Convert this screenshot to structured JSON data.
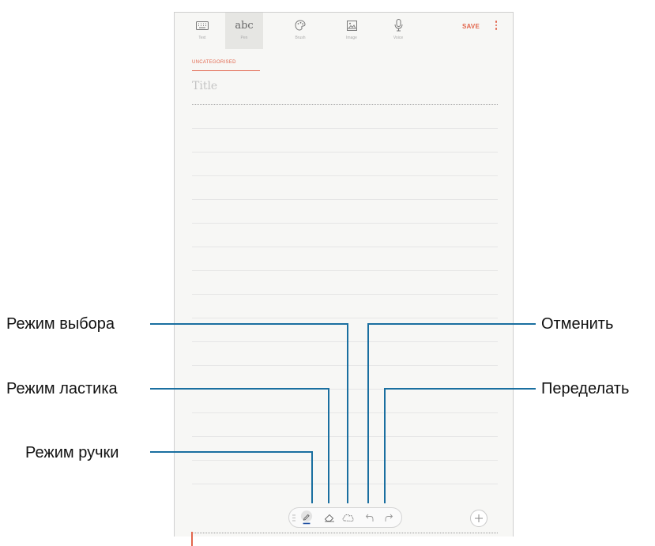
{
  "toolbar": {
    "tools": [
      {
        "label": "Text",
        "icon": "keyboard-icon"
      },
      {
        "label": "Pen",
        "icon": "abc-icon",
        "glyph": "abc"
      },
      {
        "label": "Brush",
        "icon": "palette-icon"
      },
      {
        "label": "Image",
        "icon": "image-icon"
      },
      {
        "label": "Voice",
        "icon": "microphone-icon"
      }
    ],
    "save_label": "SAVE"
  },
  "note": {
    "category": "UNCATEGORISED",
    "title_placeholder": "Title"
  },
  "pen_toolbar": {
    "items": [
      "drag-handle-icon",
      "pen-icon",
      "eraser-icon",
      "selection-lasso-icon",
      "undo-icon",
      "redo-icon"
    ],
    "active": "pen-icon"
  },
  "callouts": {
    "selection_mode": "Режим выбора",
    "eraser_mode": "Режим ластика",
    "pen_mode": "Режим ручки",
    "undo": "Отменить",
    "redo": "Переделать"
  },
  "colors": {
    "accent": "#e2664d",
    "leader_line": "#1a6fa0",
    "active_tool_bg": "#e6e6e3"
  }
}
